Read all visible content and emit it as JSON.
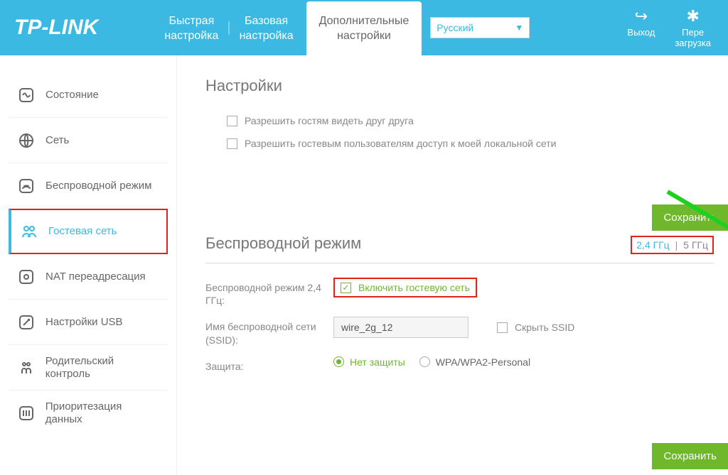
{
  "brand": "TP-LINK",
  "header": {
    "tab_quick": "Быстрая\nнастройка",
    "tab_basic": "Базовая\nнастройка",
    "tab_advanced": "Дополнительные\nнастройки",
    "language": "Русский",
    "logout": "Выход",
    "reboot": "Пере\nзагрузка"
  },
  "sidebar": {
    "items": [
      {
        "label": "Состояние"
      },
      {
        "label": "Сеть"
      },
      {
        "label": "Беспроводной режим"
      },
      {
        "label": "Гостевая сеть"
      },
      {
        "label": "NAT переадресация"
      },
      {
        "label": "Настройки USB"
      },
      {
        "label": "Родительский контроль"
      },
      {
        "label": "Приоритезация данных"
      }
    ]
  },
  "settings": {
    "title": "Настройки",
    "allow_guests_see": "Разрешить гостям видеть друг друга",
    "allow_guests_lan": "Разрешить гостевым пользователям доступ к моей локальной сети",
    "save": "Сохранить"
  },
  "wireless": {
    "title": "Беспроводной режим",
    "freq_24": "2,4 ГГц",
    "freq_5": "5 ГГц",
    "mode_24_label": "Беспроводной режим 2,4 ГГц:",
    "enable_guest": "Включить гостевую сеть",
    "ssid_label": "Имя беспроводной сети (SSID):",
    "ssid_value": "wire_2g_12",
    "hide_ssid": "Скрыть SSID",
    "security_label": "Защита:",
    "security_none": "Нет защиты",
    "security_wpa": "WPA/WPA2-Personal",
    "save": "Сохранить"
  }
}
